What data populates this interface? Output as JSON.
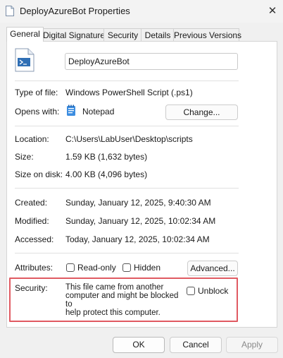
{
  "window": {
    "title": "DeployAzureBot Properties",
    "close_glyph": "✕"
  },
  "tabs": [
    {
      "label": "General",
      "active": true
    },
    {
      "label": "Digital Signatures",
      "active": false
    },
    {
      "label": "Security",
      "active": false
    },
    {
      "label": "Details",
      "active": false
    },
    {
      "label": "Previous Versions",
      "active": false
    }
  ],
  "general": {
    "file_name": "DeployAzureBot",
    "type_label": "Type of file:",
    "type_value": "Windows PowerShell Script (.ps1)",
    "opens_label": "Opens with:",
    "opens_value": "Notepad",
    "change_button": "Change...",
    "location_label": "Location:",
    "location_value": "C:\\Users\\LabUser\\Desktop\\scripts",
    "size_label": "Size:",
    "size_value": "1.59 KB (1,632 bytes)",
    "size_disk_label": "Size on disk:",
    "size_disk_value": "4.00 KB (4,096 bytes)",
    "created_label": "Created:",
    "created_value": "Sunday, January 12, 2025, 9:40:30 AM",
    "modified_label": "Modified:",
    "modified_value": "Sunday, January 12, 2025, 10:02:34 AM",
    "accessed_label": "Accessed:",
    "accessed_value": "Today, January 12, 2025, 10:02:34 AM",
    "attributes_label": "Attributes:",
    "readonly_label": "Read-only",
    "readonly_checked": false,
    "hidden_label": "Hidden",
    "hidden_checked": false,
    "advanced_button": "Advanced...",
    "security_label": "Security:",
    "security_text": [
      "This file came from another",
      "computer and might be blocked to",
      "help protect this computer."
    ],
    "unblock_label": "Unblock",
    "unblock_checked": false
  },
  "footer": {
    "ok": "OK",
    "cancel": "Cancel",
    "apply": "Apply"
  },
  "colors": {
    "highlight_border": "#e05a62",
    "apply_disabled_text": "#8a8a8a"
  }
}
